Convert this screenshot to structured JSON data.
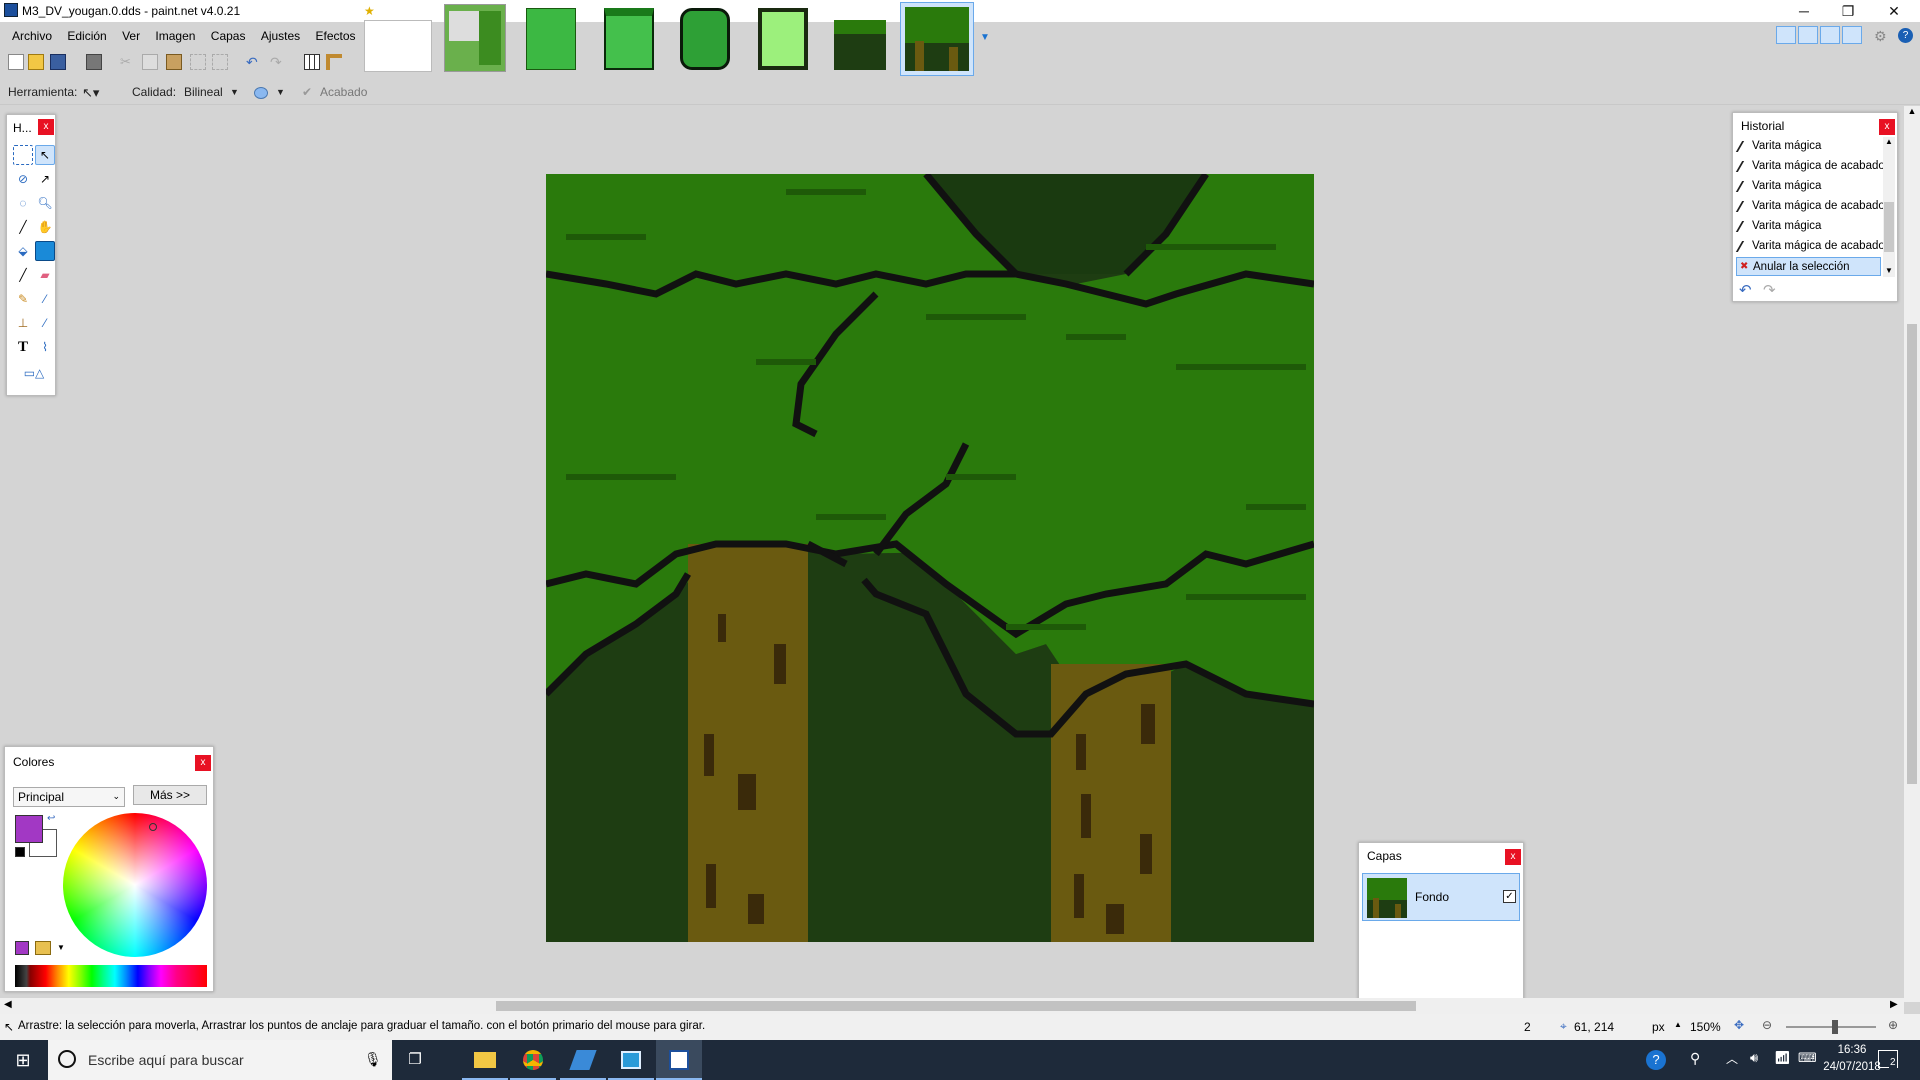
{
  "window": {
    "title": "M3_DV_yougan.0.dds - paint.net v4.0.21",
    "controls": {
      "minimize": "─",
      "maximize": "❐",
      "close": "✕"
    }
  },
  "menu": [
    "Archivo",
    "Edición",
    "Ver",
    "Imagen",
    "Capas",
    "Ajustes",
    "Efectos"
  ],
  "options_bar": {
    "tool_label": "Herramienta:",
    "quality_label": "Calidad:",
    "quality_value": "Bilineal",
    "finish_label": "Acabado"
  },
  "tools_panel": {
    "title": "H...",
    "close": "x"
  },
  "history_panel": {
    "title": "Historial",
    "close": "x",
    "items": [
      "Varita mágica",
      "Varita mágica de acabado",
      "Varita mágica",
      "Varita mágica de acabado",
      "Varita mágica",
      "Varita mágica de acabado",
      "Anular la selección"
    ],
    "selected_index": 6
  },
  "colors_panel": {
    "title": "Colores",
    "close": "x",
    "mode_select": "Principal",
    "more_button": "Más >>",
    "primary_color": "#a238c4",
    "secondary_color": "#ffffff"
  },
  "layers_panel": {
    "title": "Capas",
    "close": "x",
    "layers": [
      {
        "name": "Fondo",
        "visible": true
      }
    ]
  },
  "status": {
    "hint": "Arrastre: la selección para moverla, Arrastrar los puntos de anclaje para graduar el tamaño. con el botón primario del mouse para girar.",
    "selection_size": "2",
    "cursor_pos": "61, 214",
    "unit": "px",
    "zoom": "150%"
  },
  "taskbar": {
    "search_placeholder": "Escribe aquí para buscar",
    "time": "16:36",
    "date": "24/07/2018",
    "notif_count": "2"
  },
  "colors": {
    "canopy": "#2a7a0c",
    "canopy_dark": "#1e5a08",
    "outline": "#111111",
    "bg_forest": "#1e3d12",
    "trunk": "#6a5a10",
    "trunk_dark": "#3a2a0a",
    "accent_blue": "#0078d7"
  }
}
